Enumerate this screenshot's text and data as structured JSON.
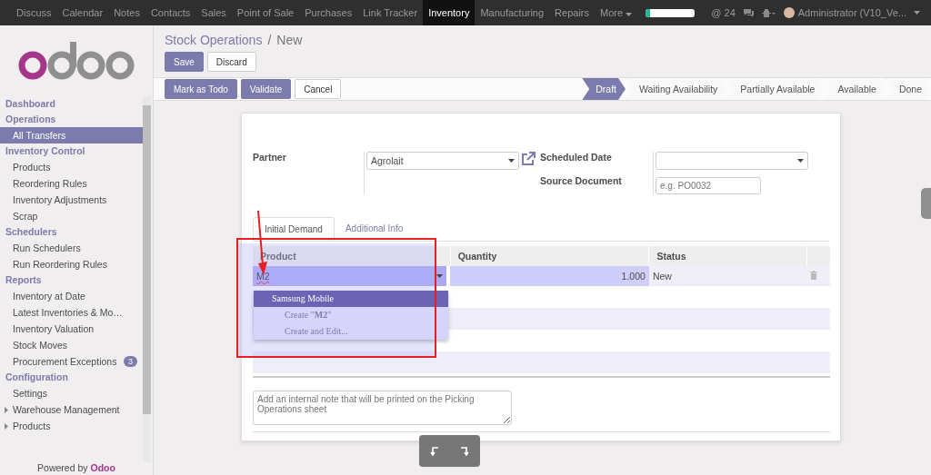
{
  "top_nav": {
    "apps": [
      {
        "label": "Discuss",
        "selected": false
      },
      {
        "label": "Calendar",
        "selected": false
      },
      {
        "label": "Notes",
        "selected": false
      },
      {
        "label": "Contacts",
        "selected": false
      },
      {
        "label": "Sales",
        "selected": false
      },
      {
        "label": "Point of Sale",
        "selected": false
      },
      {
        "label": "Purchases",
        "selected": false
      },
      {
        "label": "Link Tracker",
        "selected": false
      },
      {
        "label": "Inventory",
        "selected": true
      },
      {
        "label": "Manufacturing",
        "selected": false
      },
      {
        "label": "Repairs",
        "selected": false
      }
    ],
    "more": "More",
    "progress": {
      "level": 0.08
    },
    "mentions": {
      "icon": "@",
      "count": "24"
    },
    "user": "Administrator (V10_Ve..."
  },
  "sidebar": {
    "sections": [
      {
        "title": "Dashboard"
      },
      {
        "title": "Operations",
        "items": [
          {
            "label": "All Transfers",
            "kind": "link",
            "selected": true
          }
        ]
      },
      {
        "title": "Inventory Control",
        "items": [
          {
            "label": "Products",
            "kind": "link",
            "selected": false
          },
          {
            "label": "Reordering Rules",
            "kind": "link",
            "selected": false
          },
          {
            "label": "Inventory Adjustments",
            "kind": "link",
            "selected": false
          },
          {
            "label": "Scrap",
            "kind": "link",
            "selected": false
          }
        ]
      },
      {
        "title": "Schedulers",
        "items": [
          {
            "label": "Run Schedulers",
            "kind": "link",
            "selected": false
          },
          {
            "label": "Run Reordering Rules",
            "kind": "link",
            "selected": false
          }
        ]
      },
      {
        "title": "Reports",
        "items": [
          {
            "label": "Inventory at Date",
            "kind": "link",
            "selected": false
          },
          {
            "label": "Latest Inventories & Mo…",
            "kind": "link",
            "selected": false
          },
          {
            "label": "Inventory Valuation",
            "kind": "link",
            "selected": false
          },
          {
            "label": "Stock Moves",
            "kind": "link",
            "selected": false
          },
          {
            "label": "Procurement Exceptions",
            "kind": "link",
            "selected": false,
            "badge": "3"
          }
        ]
      },
      {
        "title": "Configuration",
        "items": [
          {
            "label": "Settings",
            "kind": "link",
            "selected": false
          },
          {
            "label": "Warehouse Management",
            "kind": "folder",
            "selected": false
          },
          {
            "label": "Products",
            "kind": "folder",
            "selected": false
          }
        ]
      }
    ],
    "footer": {
      "text": "Powered by",
      "brand": "Odoo"
    }
  },
  "breadcrumb": {
    "parent": "Stock Operations",
    "separator": "/",
    "current": "New"
  },
  "edit_buttons": [
    {
      "label": "Save",
      "kind": "primary"
    },
    {
      "label": "Discard",
      "kind": "default"
    }
  ],
  "action_buttons": [
    {
      "label": "Mark as Todo",
      "kind": "primary"
    },
    {
      "label": "Validate",
      "kind": "primary"
    },
    {
      "label": "Cancel",
      "kind": "default"
    }
  ],
  "status_steps": [
    {
      "label": "Draft",
      "selected": true
    },
    {
      "label": "Waiting Availability",
      "selected": false
    },
    {
      "label": "Partially Available",
      "selected": false
    },
    {
      "label": "Available",
      "selected": false
    },
    {
      "label": "Done",
      "selected": false
    }
  ],
  "form": {
    "partner": {
      "label": "Partner",
      "value": "Agrolait"
    },
    "scheduled_date": {
      "label": "Scheduled Date"
    },
    "source_document": {
      "label": "Source Document",
      "placeholder": "e.g. PO0032"
    }
  },
  "tabs": [
    {
      "label": "Initial Demand",
      "selected": true
    },
    {
      "label": "Additional Info",
      "selected": false
    }
  ],
  "table": {
    "columns": [
      "Product",
      "Quantity",
      "Status"
    ],
    "rows": [
      {
        "product": "M2",
        "quantity": "1.000",
        "status": "New"
      }
    ]
  },
  "autocomplete": [
    {
      "label": "Samsung Mobile",
      "selected": true
    },
    {
      "label": "Create \"**M2**\"",
      "selected": false
    },
    {
      "label": "Create and Edit...",
      "selected": false
    }
  ],
  "note": {
    "placeholder": "Add an internal note that will be printed on the Picking Operations sheet"
  }
}
